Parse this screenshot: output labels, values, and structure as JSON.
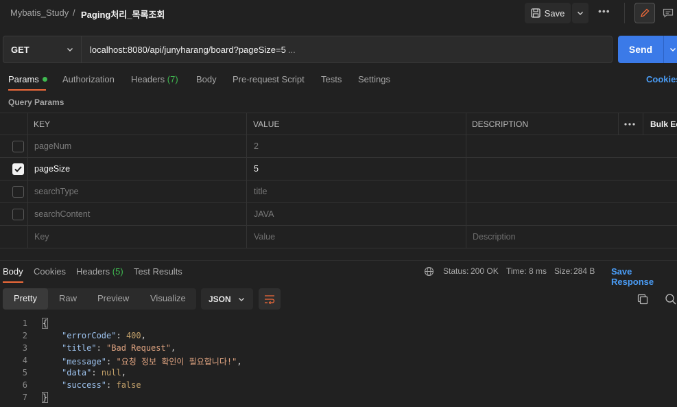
{
  "breadcrumb": {
    "collection": "Mybatis_Study",
    "separator": "/",
    "request": "Paging처리_목록조회"
  },
  "toolbar": {
    "save_label": "Save",
    "more_label": "•••"
  },
  "request": {
    "method": "GET",
    "url": "localhost:8080/api/junyharang/board?pageSize=5",
    "url_ellipsis": "...",
    "send_label": "Send"
  },
  "request_tabs": {
    "params": "Params",
    "authorization": "Authorization",
    "headers": "Headers",
    "headers_count": "(7)",
    "body": "Body",
    "pre_request": "Pre-request Script",
    "tests": "Tests",
    "settings": "Settings",
    "cookies": "Cookies"
  },
  "query_params": {
    "title": "Query Params",
    "columns": {
      "key": "KEY",
      "value": "VALUE",
      "description": "DESCRIPTION",
      "bulk_edit": "Bulk Edit"
    },
    "rows": [
      {
        "key": "pageNum",
        "value": "2",
        "checked": false
      },
      {
        "key": "pageSize",
        "value": "5",
        "checked": true
      },
      {
        "key": "searchType",
        "value": "title",
        "checked": false
      },
      {
        "key": "searchContent",
        "value": "JAVA",
        "checked": false
      }
    ],
    "placeholders": {
      "key": "Key",
      "value": "Value",
      "description": "Description"
    }
  },
  "response_tabs": {
    "body": "Body",
    "cookies": "Cookies",
    "headers": "Headers",
    "headers_count": "(5)",
    "test_results": "Test Results"
  },
  "response_meta": {
    "status_label": "Status:",
    "status_value": "200 OK",
    "time_label": "Time:",
    "time_value": "8 ms",
    "size_label": "Size:",
    "size_value": "284 B",
    "save_response": "Save Response"
  },
  "format": {
    "pretty": "Pretty",
    "raw": "Raw",
    "preview": "Preview",
    "visualize": "Visualize",
    "language": "JSON"
  },
  "code": {
    "line_numbers": [
      "1",
      "2",
      "3",
      "4",
      "5",
      "6",
      "7"
    ],
    "open_brace": "{",
    "close_brace": "}",
    "lines": [
      {
        "key": "\"errorCode\"",
        "value": "400",
        "type": "number"
      },
      {
        "key": "\"title\"",
        "value": "\"Bad Request\"",
        "type": "string"
      },
      {
        "key": "\"message\"",
        "value": "\"요청 정보 확인이 필요합니다!\"",
        "type": "string"
      },
      {
        "key": "\"data\"",
        "value": "null",
        "type": "number"
      },
      {
        "key": "\"success\"",
        "value": "false",
        "type": "number",
        "last": true
      }
    ]
  },
  "colors": {
    "accent_orange": "#f26b3a",
    "send_blue": "#3b7ae8",
    "link_blue": "#4a9cf5",
    "status_green": "#3fb950"
  }
}
